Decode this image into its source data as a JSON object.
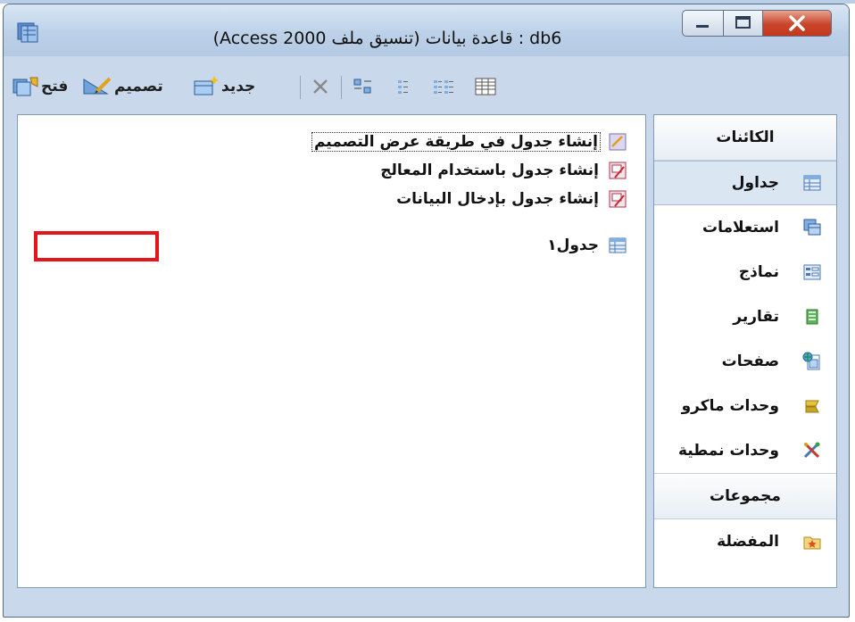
{
  "window": {
    "title": "db6 : قاعدة بيانات (تنسيق ملف Access 2000)"
  },
  "toolbar": {
    "open_label": "فتح",
    "design_label": "تصميم",
    "new_label": "جديد"
  },
  "list_items": [
    {
      "label": "إنشاء جدول في طريقة عرض التصميم",
      "icon": "design-wizard-icon"
    },
    {
      "label": "إنشاء جدول باستخدام المعالج",
      "icon": "wizard-icon"
    },
    {
      "label": "إنشاء جدول بإدخال البيانات",
      "icon": "wizard-icon"
    },
    {
      "label": "جدول١",
      "icon": "table-icon"
    }
  ],
  "objects_bar": {
    "objects_header": "الكائنات",
    "items": [
      {
        "label": "جداول",
        "icon": "table-icon"
      },
      {
        "label": "استعلامات",
        "icon": "query-icon"
      },
      {
        "label": "نماذج",
        "icon": "form-icon"
      },
      {
        "label": "تقارير",
        "icon": "report-icon"
      },
      {
        "label": "صفحات",
        "icon": "page-icon"
      },
      {
        "label": "وحدات ماكرو",
        "icon": "macro-icon"
      },
      {
        "label": "وحدات نمطية",
        "icon": "module-icon"
      }
    ],
    "groups_header": "مجموعات",
    "groups": [
      {
        "label": "المفضلة",
        "icon": "favorites-folder-icon"
      }
    ]
  },
  "colors": {
    "highlight": "#e4151b",
    "close_button": "#c8452a"
  }
}
